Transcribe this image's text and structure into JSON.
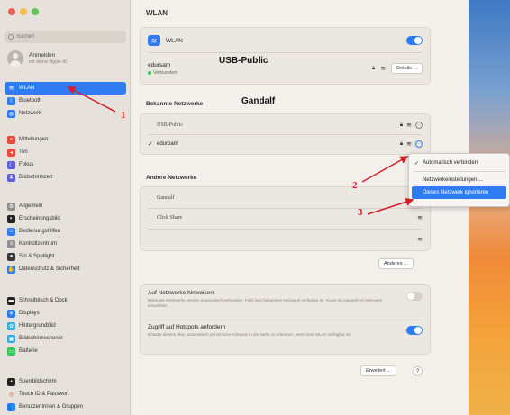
{
  "sidebar": {
    "search_placeholder": "Suchen",
    "account": {
      "title": "Anmelden",
      "subtitle": "mit deiner Apple-ID"
    },
    "group1": [
      {
        "label": "WLAN",
        "icon": "wifi-icon",
        "color": "#2f7bf2",
        "active": true
      },
      {
        "label": "Bluetooth",
        "icon": "bluetooth-icon",
        "color": "#2f7bf2"
      },
      {
        "label": "Netzwerk",
        "icon": "globe-icon",
        "color": "#2f7bf2"
      }
    ],
    "group2": [
      {
        "label": "Mitteilungen",
        "icon": "bell-icon",
        "color": "#e84a3c"
      },
      {
        "label": "Ton",
        "icon": "speaker-icon",
        "color": "#e84a3c"
      },
      {
        "label": "Fokus",
        "icon": "moon-icon",
        "color": "#5b5fd6"
      },
      {
        "label": "Bildschirmzeit",
        "icon": "hourglass-icon",
        "color": "#5b5fd6"
      }
    ],
    "group3": [
      {
        "label": "Allgemein",
        "icon": "gear-icon",
        "color": "#8e8e93"
      },
      {
        "label": "Erscheinungsbild",
        "icon": "appearance-icon",
        "color": "#222222"
      },
      {
        "label": "Bedienungshilfen",
        "icon": "accessibility-icon",
        "color": "#2f7bf2"
      },
      {
        "label": "Kontrollzentrum",
        "icon": "control-center-icon",
        "color": "#8e8e93"
      },
      {
        "label": "Siri & Spotlight",
        "icon": "siri-icon",
        "color": "#3a3a3c"
      },
      {
        "label": "Datenschutz & Sicherheit",
        "icon": "hand-icon",
        "color": "#2f7bf2"
      }
    ],
    "group4": [
      {
        "label": "Schreibtisch & Dock",
        "icon": "dock-icon",
        "color": "#222222"
      },
      {
        "label": "Displays",
        "icon": "display-icon",
        "color": "#2f7bf2"
      },
      {
        "label": "Hintergrundbild",
        "icon": "wallpaper-icon",
        "color": "#35aadc"
      },
      {
        "label": "Bildschirmschoner",
        "icon": "screensaver-icon",
        "color": "#35aadc"
      },
      {
        "label": "Batterie",
        "icon": "battery-icon",
        "color": "#34c759"
      }
    ],
    "group5": [
      {
        "label": "Sperrbildschirm",
        "icon": "lock-screen-icon",
        "color": "#222222"
      },
      {
        "label": "Touch ID & Passwort",
        "icon": "fingerprint-icon",
        "color": "#e8e3dc"
      },
      {
        "label": "Benutzer:innen & Gruppen",
        "icon": "users-icon",
        "color": "#2f7bf2"
      }
    ]
  },
  "main": {
    "title": "WLAN",
    "wlan_label": "WLAN",
    "current": {
      "name": "edursam",
      "status": "Verbunden",
      "details_button": "Details ..."
    },
    "known_title": "Bekannte Netzwerke",
    "known": [
      {
        "name": "USB-Public",
        "checked": false
      },
      {
        "name": "eduroam",
        "checked": true
      }
    ],
    "other_title": "Andere Netzwerke",
    "other": [
      {
        "name": "Gandalf",
        "lock": true
      },
      {
        "name": "Click Share",
        "lock": false
      },
      {
        "name": "",
        "lock": false
      }
    ],
    "other_button": "Anderes ...",
    "hint": {
      "title": "Auf Netzwerke hinweisen",
      "desc": "Bekannte Netzwerke werden automatisch verbunden. Falls kein bekanntes Netzwerk verfügbar ist, musst du manuell ein Netzwerk auswählen."
    },
    "hotspot": {
      "title": "Zugriff auf Hotspots anfordern",
      "desc": "Erlaube diesem Mac, automatisch persönliche Hotspots in der Nähe zu erkennen, wenn kein WLAN verfügbar ist."
    },
    "advanced_button": "Erweitert ...",
    "help": "?"
  },
  "context_menu": {
    "check": "✓",
    "items": [
      "Automatisch verbinden",
      "Netzwerkeinstellungen ...",
      "Dieses Netzwerk ignorieren"
    ]
  },
  "annotations": {
    "usb_label": "USB-Public",
    "gandalf_label": "Gandalf",
    "num1": "1",
    "num2": "2",
    "num3": "3"
  },
  "colors": {
    "accent": "#2f7bf2",
    "annotation_red": "#d21f2a",
    "connected_green": "#34c759"
  }
}
